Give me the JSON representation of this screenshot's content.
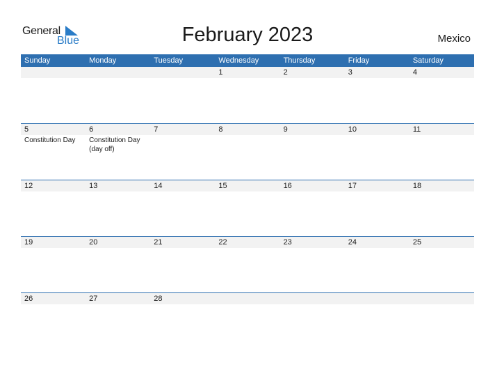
{
  "logo": {
    "line1": "General",
    "line2": "Blue"
  },
  "title": "February 2023",
  "country": "Mexico",
  "colors": {
    "header_bg": "#2e6fb0",
    "accent": "#2a7cc7",
    "date_row_bg": "#f2f2f2"
  },
  "weekdays": [
    "Sunday",
    "Monday",
    "Tuesday",
    "Wednesday",
    "Thursday",
    "Friday",
    "Saturday"
  ],
  "weeks": [
    {
      "dates": [
        "",
        "",
        "",
        "1",
        "2",
        "3",
        "4"
      ],
      "events": [
        "",
        "",
        "",
        "",
        "",
        "",
        ""
      ]
    },
    {
      "dates": [
        "5",
        "6",
        "7",
        "8",
        "9",
        "10",
        "11"
      ],
      "events": [
        "Constitution Day",
        "Constitution Day\n(day off)",
        "",
        "",
        "",
        "",
        ""
      ]
    },
    {
      "dates": [
        "12",
        "13",
        "14",
        "15",
        "16",
        "17",
        "18"
      ],
      "events": [
        "",
        "",
        "",
        "",
        "",
        "",
        ""
      ]
    },
    {
      "dates": [
        "19",
        "20",
        "21",
        "22",
        "23",
        "24",
        "25"
      ],
      "events": [
        "",
        "",
        "",
        "",
        "",
        "",
        ""
      ]
    },
    {
      "dates": [
        "26",
        "27",
        "28",
        "",
        "",
        "",
        ""
      ],
      "events": [
        "",
        "",
        "",
        "",
        "",
        "",
        ""
      ]
    }
  ]
}
